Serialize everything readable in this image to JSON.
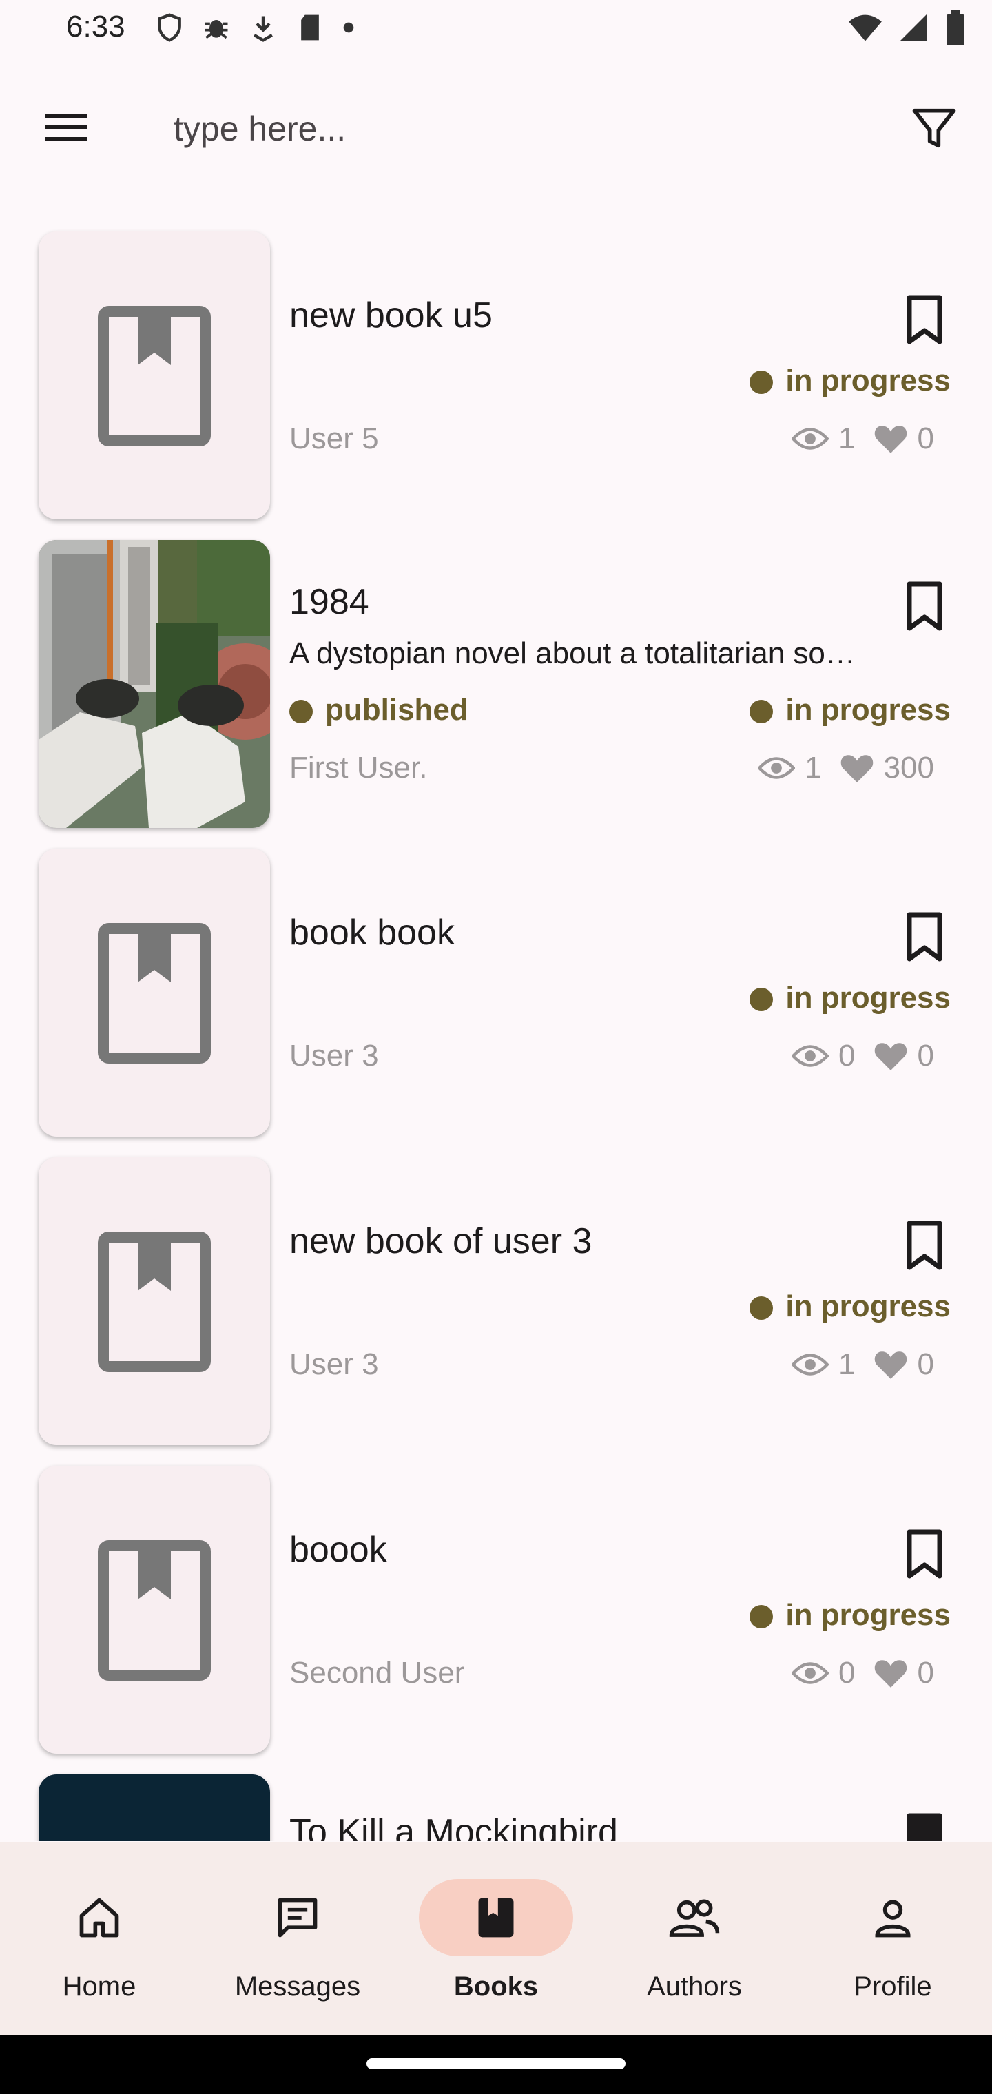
{
  "status_bar": {
    "time": "6:33"
  },
  "search": {
    "placeholder": "type here..."
  },
  "books": [
    {
      "title": "new book u5",
      "description": "",
      "published_label": "",
      "status": "in progress",
      "author": "User 5",
      "views": "1",
      "likes": "0",
      "cover": "placeholder"
    },
    {
      "title": "1984",
      "description": "A dystopian novel about a totalitarian so…",
      "published_label": "published",
      "status": "in progress",
      "author": "First User.",
      "views": "1",
      "likes": "300",
      "cover": "photo"
    },
    {
      "title": "book book",
      "description": "",
      "published_label": "",
      "status": "in progress",
      "author": "User 3",
      "views": "0",
      "likes": "0",
      "cover": "placeholder"
    },
    {
      "title": "new book of user 3",
      "description": "",
      "published_label": "",
      "status": "in progress",
      "author": "User 3",
      "views": "1",
      "likes": "0",
      "cover": "placeholder"
    },
    {
      "title": "boook",
      "description": "",
      "published_label": "",
      "status": "in progress",
      "author": "Second User",
      "views": "0",
      "likes": "0",
      "cover": "placeholder"
    },
    {
      "title": "To Kill a Mockingbird",
      "description": "",
      "published_label": "",
      "status": "",
      "author": "",
      "views": "",
      "likes": "",
      "cover": "dark"
    }
  ],
  "nav": {
    "active": "Books",
    "items": [
      {
        "label": "Home",
        "icon": "home-icon"
      },
      {
        "label": "Messages",
        "icon": "messages-icon"
      },
      {
        "label": "Books",
        "icon": "book-icon"
      },
      {
        "label": "Authors",
        "icon": "people-icon"
      },
      {
        "label": "Profile",
        "icon": "person-icon"
      }
    ]
  },
  "colors": {
    "background": "#fdf8fa",
    "status_accent": "#6b5e2c",
    "nav_background": "#f6ecea",
    "nav_active_pill": "#f8cfc3",
    "muted_text": "#9c9899"
  }
}
